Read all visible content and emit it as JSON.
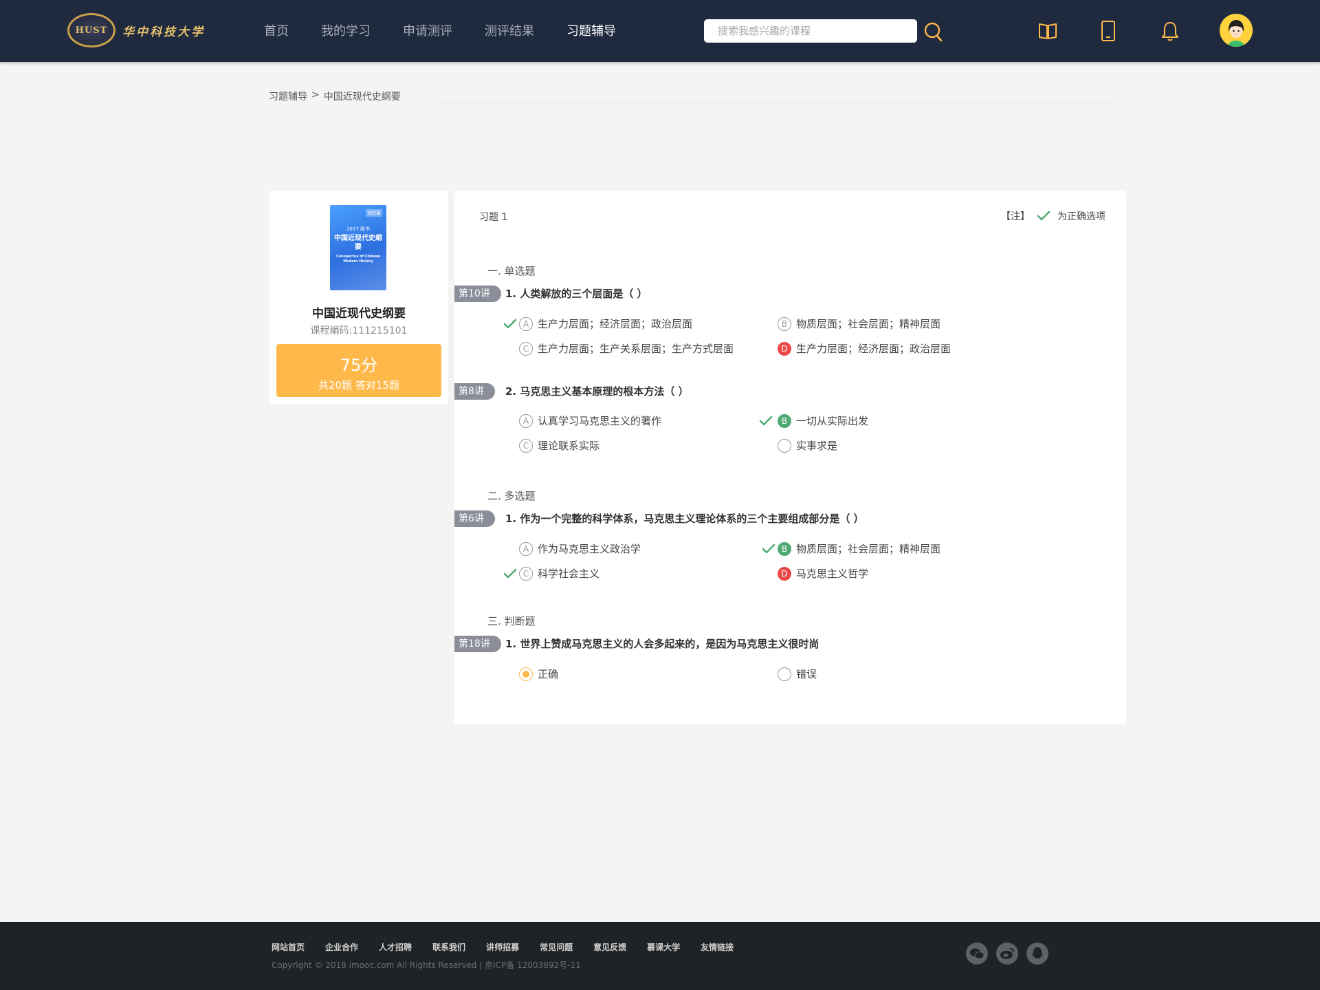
{
  "header": {
    "logo_text": "华中科技大学",
    "logo_emblem_text": "HUST",
    "nav": [
      {
        "label": "首页",
        "active": false
      },
      {
        "label": "我的学习",
        "active": false
      },
      {
        "label": "申请测评",
        "active": false
      },
      {
        "label": "测评结果",
        "active": false
      },
      {
        "label": "习题辅导",
        "active": true
      }
    ],
    "search_placeholder": "搜索我感兴趣的课程",
    "icons": [
      "book-icon",
      "mobile-icon",
      "bell-icon"
    ],
    "accent_color": "#ffb84a"
  },
  "breadcrumb": {
    "parent": "习题辅导",
    "separator": ">",
    "current": "中国近现代史纲要"
  },
  "course": {
    "cover_tag": "研究课",
    "cover_year": "2017 版书",
    "cover_title": "中国近现代史纲要",
    "cover_subtitle": "Conspectus of Chinese Modern History",
    "name": "中国近现代史纲要",
    "code": "课程编码:111215101",
    "score": "75分",
    "score_detail": "共20题   答对15题"
  },
  "quiz": {
    "title": "习题 1",
    "legend_prefix": "【注】",
    "legend_text": "为正确选项",
    "correct_color": "#4eaa72",
    "wrong_color": "#e84848",
    "sections": [
      {
        "title": "一. 单选题"
      },
      {
        "title": "二. 多选题"
      },
      {
        "title": "三. 判断题"
      }
    ],
    "questions": [
      {
        "lecture": "第10讲",
        "text": "1. 人类解放的三个层面是（    ）",
        "options": [
          {
            "letter": "A",
            "text": "生产力层面；经济层面；政治层面",
            "state": "plain",
            "marked_correct": true
          },
          {
            "letter": "B",
            "text": "物质层面；社会层面；精神层面",
            "state": "plain",
            "marked_correct": false
          },
          {
            "letter": "C",
            "text": "生产力层面；生产关系层面；生产方式层面",
            "state": "plain",
            "marked_correct": false
          },
          {
            "letter": "D",
            "text": "生产力层面；经济层面；政治层面",
            "state": "wrong",
            "marked_correct": false
          }
        ]
      },
      {
        "lecture": "第8讲",
        "text": "2. 马克思主义基本原理的根本方法（    ）",
        "options": [
          {
            "letter": "A",
            "text": "认真学习马克思主义的著作",
            "state": "plain",
            "marked_correct": false
          },
          {
            "letter": "B",
            "text": "一切从实际出发",
            "state": "correct",
            "marked_correct": true
          },
          {
            "letter": "C",
            "text": "理论联系实际",
            "state": "plain",
            "marked_correct": false
          },
          {
            "letter": "",
            "text": "实事求是",
            "state": "plain",
            "marked_correct": false
          }
        ]
      },
      {
        "lecture": "第6讲",
        "text": "1. 作为一个完整的科学体系，马克思主义理论体系的三个主要组成部分是（    ）",
        "options": [
          {
            "letter": "A",
            "text": "作为马克思主义政治学",
            "state": "plain",
            "marked_correct": false
          },
          {
            "letter": "B",
            "text": "物质层面；社会层面；精神层面",
            "state": "correct",
            "marked_correct": true
          },
          {
            "letter": "C",
            "text": "科学社会主义",
            "state": "plain",
            "marked_correct": true
          },
          {
            "letter": "D",
            "text": "马克思主义哲学",
            "state": "wrong",
            "marked_correct": false
          }
        ]
      },
      {
        "lecture": "第18讲",
        "text": "1. 世界上赞成马克思主义的人会多起来的，是因为马克思主义很时尚",
        "options": [
          {
            "letter": "",
            "text": "正确",
            "state": "radio-on",
            "marked_correct": false
          },
          {
            "letter": "",
            "text": "错误",
            "state": "plain",
            "marked_correct": false
          }
        ]
      }
    ]
  },
  "footer": {
    "links": [
      "网站首页",
      "企业合作",
      "人才招聘",
      "联系我们",
      "讲师招募",
      "常见问题",
      "意见反馈",
      "慕课大学",
      "友情链接"
    ],
    "copyright": "Copyright © 2018 imooc.com All Rights Reserved | 京ICP备 12003892号-11",
    "social_icons": [
      "wechat-icon",
      "weibo-icon",
      "qq-icon"
    ]
  }
}
